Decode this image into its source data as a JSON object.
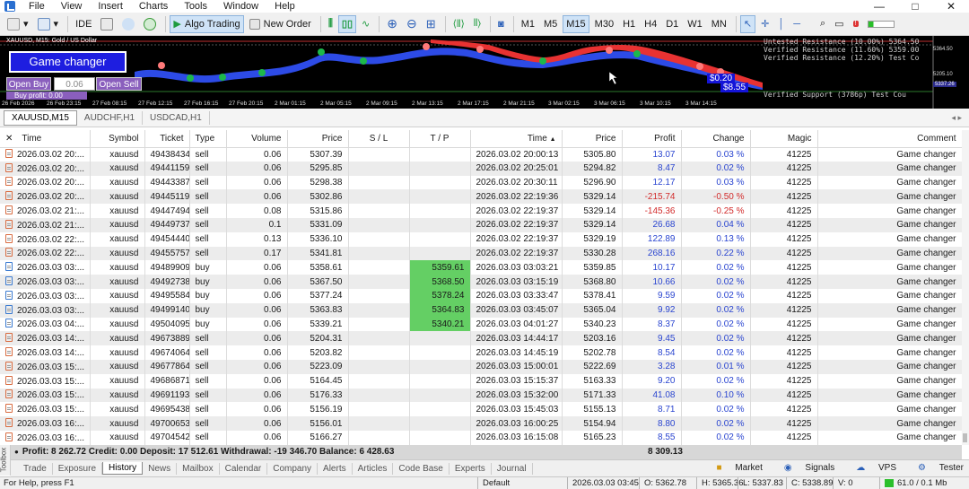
{
  "menu": {
    "items": [
      "File",
      "View",
      "Insert",
      "Charts",
      "Tools",
      "Window",
      "Help"
    ],
    "minimize": "—",
    "maximize": "□",
    "close": "✕"
  },
  "toolbar": {
    "ide_label": "IDE",
    "algo_trading_label": "Algo Trading",
    "new_order_label": "New Order",
    "timeframes": [
      "M1",
      "M5",
      "M15",
      "M30",
      "H1",
      "H4",
      "D1",
      "W1",
      "MN"
    ],
    "active_timeframe": "M15"
  },
  "chart": {
    "title": "XAUUSD, M15:  Gold / US Dollar",
    "game_changer_label": "Game changer",
    "open_buy_label": "Open Buy",
    "lot_value": "0.06",
    "open_sell_label": "Open Sell",
    "buy_profit_label": "Buy profit: 0.00",
    "right_info": [
      "Untested Resistance (10.00%) 5364.50",
      "Verified Resistance (11.60%) 5359.00",
      "Verified Resistance (12.20%) Test Co"
    ],
    "verified_support": "Verified Support (3786p)  Test Cou",
    "pl_label_1": "$0.20",
    "pl_label_2": "$8.55",
    "price_labels": [
      "5364.50",
      "5205.10",
      "5337.26"
    ],
    "time_ticks": [
      "26 Feb 2026",
      "26 Feb 23:15",
      "27 Feb 08:15",
      "27 Feb 12:15",
      "27 Feb 16:15",
      "27 Feb 20:15",
      "2 Mar 01:15",
      "2 Mar 05:15",
      "2 Mar 09:15",
      "2 Mar 13:15",
      "2 Mar 17:15",
      "2 Mar 21:15",
      "3 Mar 02:15",
      "3 Mar 06:15",
      "3 Mar 10:15",
      "3 Mar 14:15"
    ],
    "colors": {
      "background": "#000000",
      "buy_band": "#2d4be6",
      "sell_band": "#e83232",
      "marker": "#ff7a7a",
      "green_marker": "#1db84b"
    }
  },
  "chart_tabs": [
    "XAUUSD,M15",
    "AUDCHF,H1",
    "USDCAD,H1"
  ],
  "table": {
    "headers": [
      "Time",
      "Symbol",
      "Ticket",
      "Type",
      "Volume",
      "Price",
      "S / L",
      "T / P",
      "Time",
      "Price",
      "Profit",
      "Change",
      "Magic",
      "Comment"
    ],
    "sort_indicator": "▲",
    "rows": [
      {
        "time": "2026.03.02 20:...",
        "symbol": "xauusd",
        "ticket": "49438434",
        "type": "sell",
        "volume": "0.06",
        "price": "5307.39",
        "sl": "",
        "tp": "",
        "close_time": "2026.03.02 20:00:13",
        "close_price": "5305.80",
        "profit": "13.07",
        "change": "0.03 %",
        "magic": "41225",
        "comment": "Game changer"
      },
      {
        "time": "2026.03.02 20:...",
        "symbol": "xauusd",
        "ticket": "49441159",
        "type": "sell",
        "volume": "0.06",
        "price": "5295.85",
        "sl": "",
        "tp": "",
        "close_time": "2026.03.02 20:25:01",
        "close_price": "5294.82",
        "profit": "8.47",
        "change": "0.02 %",
        "magic": "41225",
        "comment": "Game changer"
      },
      {
        "time": "2026.03.02 20:...",
        "symbol": "xauusd",
        "ticket": "49443387",
        "type": "sell",
        "volume": "0.06",
        "price": "5298.38",
        "sl": "",
        "tp": "",
        "close_time": "2026.03.02 20:30:11",
        "close_price": "5296.90",
        "profit": "12.17",
        "change": "0.03 %",
        "magic": "41225",
        "comment": "Game changer"
      },
      {
        "time": "2026.03.02 20:...",
        "symbol": "xauusd",
        "ticket": "49445119",
        "type": "sell",
        "volume": "0.06",
        "price": "5302.86",
        "sl": "",
        "tp": "",
        "close_time": "2026.03.02 22:19:36",
        "close_price": "5329.14",
        "profit": "-215.74",
        "change": "-0.50 %",
        "magic": "41225",
        "comment": "Game changer"
      },
      {
        "time": "2026.03.02 21:...",
        "symbol": "xauusd",
        "ticket": "49447494",
        "type": "sell",
        "volume": "0.08",
        "price": "5315.86",
        "sl": "",
        "tp": "",
        "close_time": "2026.03.02 22:19:37",
        "close_price": "5329.14",
        "profit": "-145.36",
        "change": "-0.25 %",
        "magic": "41225",
        "comment": "Game changer"
      },
      {
        "time": "2026.03.02 21:...",
        "symbol": "xauusd",
        "ticket": "49449737",
        "type": "sell",
        "volume": "0.1",
        "price": "5331.09",
        "sl": "",
        "tp": "",
        "close_time": "2026.03.02 22:19:37",
        "close_price": "5329.14",
        "profit": "26.68",
        "change": "0.04 %",
        "magic": "41225",
        "comment": "Game changer"
      },
      {
        "time": "2026.03.02 22:...",
        "symbol": "xauusd",
        "ticket": "49454440",
        "type": "sell",
        "volume": "0.13",
        "price": "5336.10",
        "sl": "",
        "tp": "",
        "close_time": "2026.03.02 22:19:37",
        "close_price": "5329.19",
        "profit": "122.89",
        "change": "0.13 %",
        "magic": "41225",
        "comment": "Game changer"
      },
      {
        "time": "2026.03.02 22:...",
        "symbol": "xauusd",
        "ticket": "49455757",
        "type": "sell",
        "volume": "0.17",
        "price": "5341.81",
        "sl": "",
        "tp": "",
        "close_time": "2026.03.02 22:19:37",
        "close_price": "5330.28",
        "profit": "268.16",
        "change": "0.22 %",
        "magic": "41225",
        "comment": "Game changer"
      },
      {
        "time": "2026.03.03 03:...",
        "symbol": "xauusd",
        "ticket": "49489909",
        "type": "buy",
        "volume": "0.06",
        "price": "5358.61",
        "sl": "",
        "tp": "5359.61",
        "close_time": "2026.03.03 03:03:21",
        "close_price": "5359.85",
        "profit": "10.17",
        "change": "0.02 %",
        "magic": "41225",
        "comment": "Game changer"
      },
      {
        "time": "2026.03.03 03:...",
        "symbol": "xauusd",
        "ticket": "49492738",
        "type": "buy",
        "volume": "0.06",
        "price": "5367.50",
        "sl": "",
        "tp": "5368.50",
        "close_time": "2026.03.03 03:15:19",
        "close_price": "5368.80",
        "profit": "10.66",
        "change": "0.02 %",
        "magic": "41225",
        "comment": "Game changer"
      },
      {
        "time": "2026.03.03 03:...",
        "symbol": "xauusd",
        "ticket": "49495584",
        "type": "buy",
        "volume": "0.06",
        "price": "5377.24",
        "sl": "",
        "tp": "5378.24",
        "close_time": "2026.03.03 03:33:47",
        "close_price": "5378.41",
        "profit": "9.59",
        "change": "0.02 %",
        "magic": "41225",
        "comment": "Game changer"
      },
      {
        "time": "2026.03.03 03:...",
        "symbol": "xauusd",
        "ticket": "49499140",
        "type": "buy",
        "volume": "0.06",
        "price": "5363.83",
        "sl": "",
        "tp": "5364.83",
        "close_time": "2026.03.03 03:45:07",
        "close_price": "5365.04",
        "profit": "9.92",
        "change": "0.02 %",
        "magic": "41225",
        "comment": "Game changer"
      },
      {
        "time": "2026.03.03 04:...",
        "symbol": "xauusd",
        "ticket": "49504095",
        "type": "buy",
        "volume": "0.06",
        "price": "5339.21",
        "sl": "",
        "tp": "5340.21",
        "close_time": "2026.03.03 04:01:27",
        "close_price": "5340.23",
        "profit": "8.37",
        "change": "0.02 %",
        "magic": "41225",
        "comment": "Game changer"
      },
      {
        "time": "2026.03.03 14:...",
        "symbol": "xauusd",
        "ticket": "49673889",
        "type": "sell",
        "volume": "0.06",
        "price": "5204.31",
        "sl": "",
        "tp": "",
        "close_time": "2026.03.03 14:44:17",
        "close_price": "5203.16",
        "profit": "9.45",
        "change": "0.02 %",
        "magic": "41225",
        "comment": "Game changer"
      },
      {
        "time": "2026.03.03 14:...",
        "symbol": "xauusd",
        "ticket": "49674064",
        "type": "sell",
        "volume": "0.06",
        "price": "5203.82",
        "sl": "",
        "tp": "",
        "close_time": "2026.03.03 14:45:19",
        "close_price": "5202.78",
        "profit": "8.54",
        "change": "0.02 %",
        "magic": "41225",
        "comment": "Game changer"
      },
      {
        "time": "2026.03.03 15:...",
        "symbol": "xauusd",
        "ticket": "49677864",
        "type": "sell",
        "volume": "0.06",
        "price": "5223.09",
        "sl": "",
        "tp": "",
        "close_time": "2026.03.03 15:00:01",
        "close_price": "5222.69",
        "profit": "3.28",
        "change": "0.01 %",
        "magic": "41225",
        "comment": "Game changer"
      },
      {
        "time": "2026.03.03 15:...",
        "symbol": "xauusd",
        "ticket": "49686871",
        "type": "sell",
        "volume": "0.06",
        "price": "5164.45",
        "sl": "",
        "tp": "",
        "close_time": "2026.03.03 15:15:37",
        "close_price": "5163.33",
        "profit": "9.20",
        "change": "0.02 %",
        "magic": "41225",
        "comment": "Game changer"
      },
      {
        "time": "2026.03.03 15:...",
        "symbol": "xauusd",
        "ticket": "49691193",
        "type": "sell",
        "volume": "0.06",
        "price": "5176.33",
        "sl": "",
        "tp": "",
        "close_time": "2026.03.03 15:32:00",
        "close_price": "5171.33",
        "profit": "41.08",
        "change": "0.10 %",
        "magic": "41225",
        "comment": "Game changer"
      },
      {
        "time": "2026.03.03 15:...",
        "symbol": "xauusd",
        "ticket": "49695438",
        "type": "sell",
        "volume": "0.06",
        "price": "5156.19",
        "sl": "",
        "tp": "",
        "close_time": "2026.03.03 15:45:03",
        "close_price": "5155.13",
        "profit": "8.71",
        "change": "0.02 %",
        "magic": "41225",
        "comment": "Game changer"
      },
      {
        "time": "2026.03.03 16:...",
        "symbol": "xauusd",
        "ticket": "49700653",
        "type": "sell",
        "volume": "0.06",
        "price": "5156.01",
        "sl": "",
        "tp": "",
        "close_time": "2026.03.03 16:00:25",
        "close_price": "5154.94",
        "profit": "8.80",
        "change": "0.02 %",
        "magic": "41225",
        "comment": "Game changer"
      },
      {
        "time": "2026.03.03 16:...",
        "symbol": "xauusd",
        "ticket": "49704542",
        "type": "sell",
        "volume": "0.06",
        "price": "5166.27",
        "sl": "",
        "tp": "",
        "close_time": "2026.03.03 16:15:08",
        "close_price": "5165.23",
        "profit": "8.55",
        "change": "0.02 %",
        "magic": "41225",
        "comment": "Game changer"
      }
    ],
    "colors": {
      "tp_highlight": "#64cf64",
      "negative": "#d22b2b",
      "positive": "#2a45d0"
    }
  },
  "summary": {
    "text": "Profit: 8 262.72  Credit: 0.00  Deposit: 17 512.61  Withdrawal: -19 346.70  Balance: 6 428.63",
    "total_profit": "8 309.13"
  },
  "toolbox_label": "Toolbox",
  "bottom_tabs": [
    "Trade",
    "Exposure",
    "History",
    "News",
    "Mailbox",
    "Calendar",
    "Company",
    "Alerts",
    "Articles",
    "Code Base",
    "Experts",
    "Journal"
  ],
  "active_bottom_tab": "History",
  "right_tools": [
    "Market",
    "Signals",
    "VPS",
    "Tester"
  ],
  "status": {
    "help": "For Help, press F1",
    "profile": "Default",
    "datetime": "2026.03.03 03:45",
    "open": "O: 5362.78",
    "high": "H: 5365.36",
    "low": "L: 5337.83",
    "close": "C: 5338.89",
    "volume": "V: 0",
    "traffic": "61.0 / 0.1 Mb"
  }
}
